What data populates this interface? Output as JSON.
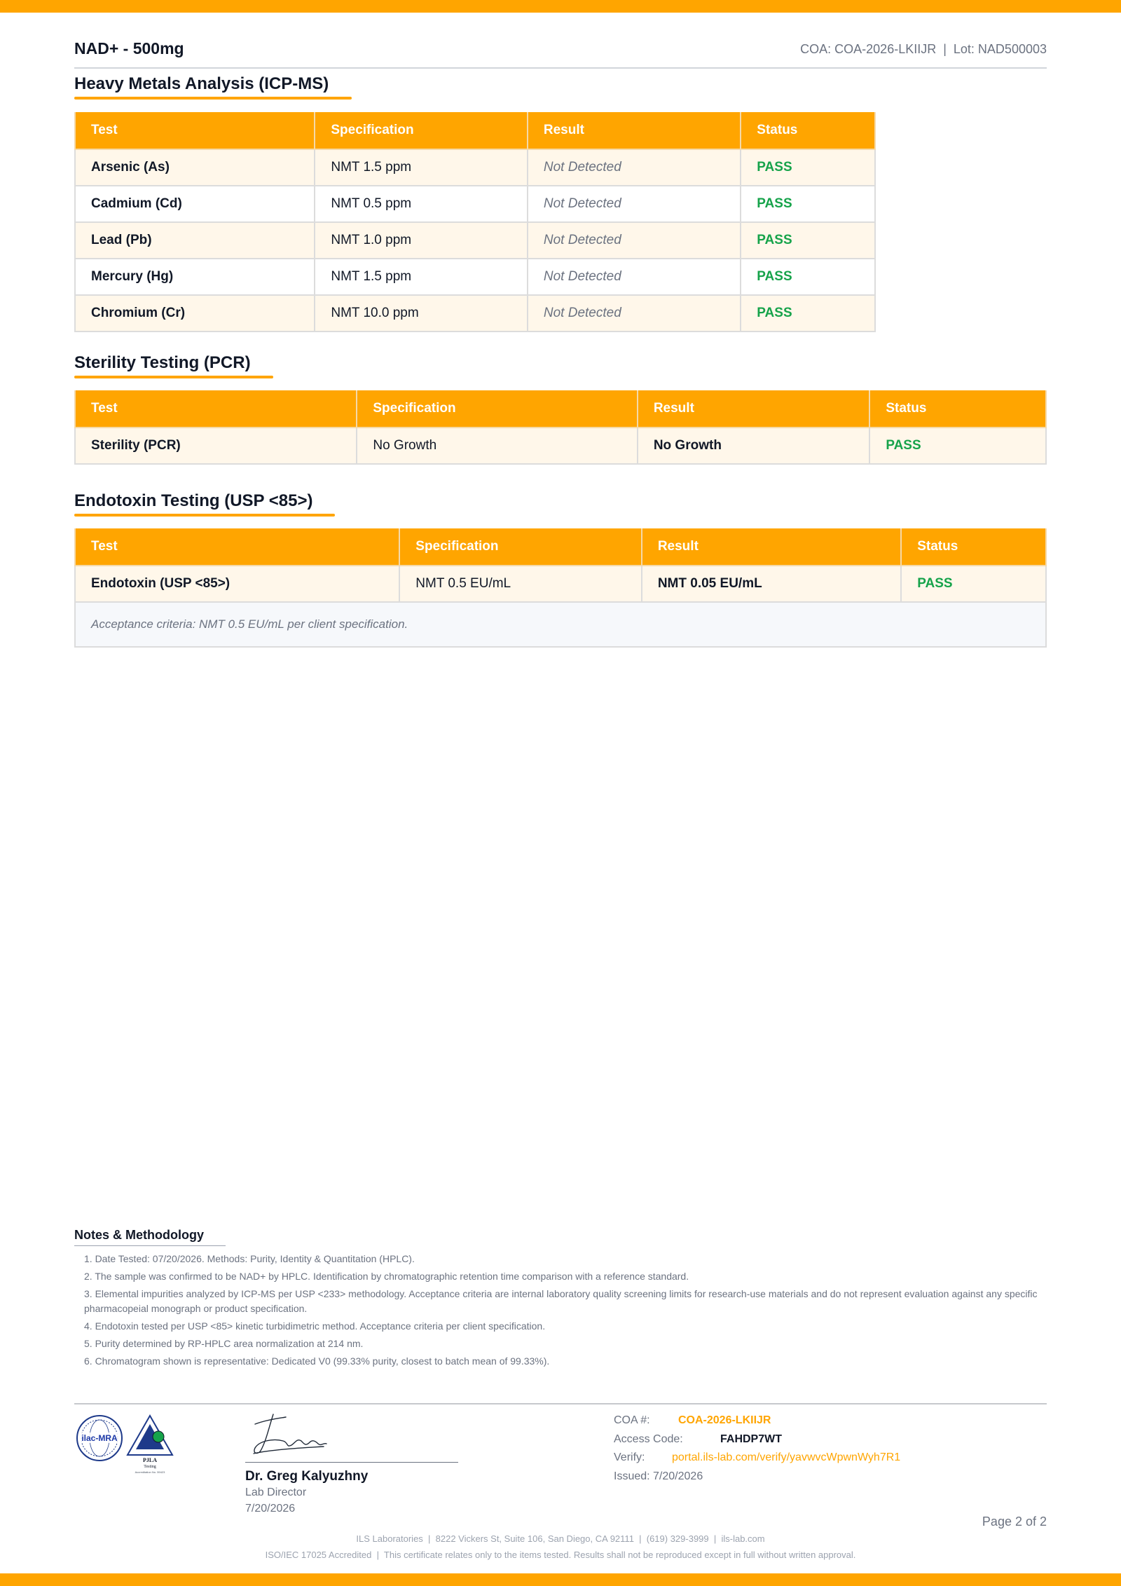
{
  "header": {
    "product": "NAD+ - 500mg",
    "coa_ref": "COA: COA-2026-LKIIJR  |  Lot: NAD500003"
  },
  "columns": [
    "Test",
    "Specification",
    "Result",
    "Status"
  ],
  "heavy_metals": {
    "title": "Heavy Metals Analysis (ICP-MS)",
    "rows": [
      {
        "test": "Arsenic (As)",
        "spec": "NMT 1.5 ppm",
        "result": "Not Detected",
        "status": "PASS"
      },
      {
        "test": "Cadmium (Cd)",
        "spec": "NMT 0.5 ppm",
        "result": "Not Detected",
        "status": "PASS"
      },
      {
        "test": "Lead (Pb)",
        "spec": "NMT 1.0 ppm",
        "result": "Not Detected",
        "status": "PASS"
      },
      {
        "test": "Mercury (Hg)",
        "spec": "NMT 1.5 ppm",
        "result": "Not Detected",
        "status": "PASS"
      },
      {
        "test": "Chromium (Cr)",
        "spec": "NMT 10.0 ppm",
        "result": "Not Detected",
        "status": "PASS"
      }
    ]
  },
  "sterility": {
    "title": "Sterility Testing (PCR)",
    "rows": [
      {
        "test": "Sterility (PCR)",
        "spec": "No Growth",
        "result": "No Growth",
        "status": "PASS"
      }
    ]
  },
  "endotoxin": {
    "title": "Endotoxin Testing (USP <85>)",
    "rows": [
      {
        "test": "Endotoxin (USP <85>)",
        "spec": "NMT 0.5 EU/mL",
        "result": "NMT 0.05 EU/mL",
        "status": "PASS"
      }
    ],
    "note": "Acceptance criteria: NMT 0.5 EU/mL per client specification."
  },
  "notes": {
    "title": "Notes & Methodology",
    "items": [
      "1. Date Tested: 07/20/2026. Methods: Purity, Identity & Quantitation (HPLC).",
      "2. The sample was confirmed to be NAD+ by HPLC. Identification by chromatographic retention time comparison with a reference standard.",
      "3. Elemental impurities analyzed by ICP-MS per USP <233> methodology. Acceptance criteria are internal laboratory quality screening limits for research-use materials and do not represent evaluation against any specific pharmacopeial monograph or product specification.",
      "4. Endotoxin tested per USP <85> kinetic turbidimetric method. Acceptance criteria per client specification.",
      "5. Purity determined by RP-HPLC area normalization at 214 nm.",
      "6. Chromatogram shown is representative: Dedicated V0 (99.33% purity, closest to batch mean of 99.33%)."
    ]
  },
  "logos": {
    "ilac_text": "ilac-MRA",
    "pjla_text": "PJLA",
    "pjla_sub": "Testing",
    "pjla_accred": "Accreditation No. 59423"
  },
  "signature": {
    "name": "Dr. Greg Kalyuzhny",
    "role": "Lab Director",
    "date": "7/20/2026"
  },
  "meta": {
    "coa_label": "COA #:",
    "coa_value": "COA-2026-LKIIJR",
    "access_label": "Access Code:",
    "access_value": "FAHDP7WT",
    "verify_label": "Verify:",
    "verify_value": "portal.ils-lab.com/verify/yavwvcWpwnWyh7R1",
    "issued": "Issued: 7/20/2026"
  },
  "footer": {
    "page": "Page 2 of 2",
    "address": "ILS Laboratories  |  8222 Vickers St, Suite 106, San Diego, CA 92111  |  (619) 329-3999  |  ils-lab.com",
    "accreditation": "ISO/IEC 17025 Accredited  |  This certificate relates only to the items tested. Results shall not be reproduced except in full without written approval."
  },
  "colors": {
    "accent": "#ffa500",
    "pass": "#16a34a",
    "muted": "#6b7280"
  }
}
